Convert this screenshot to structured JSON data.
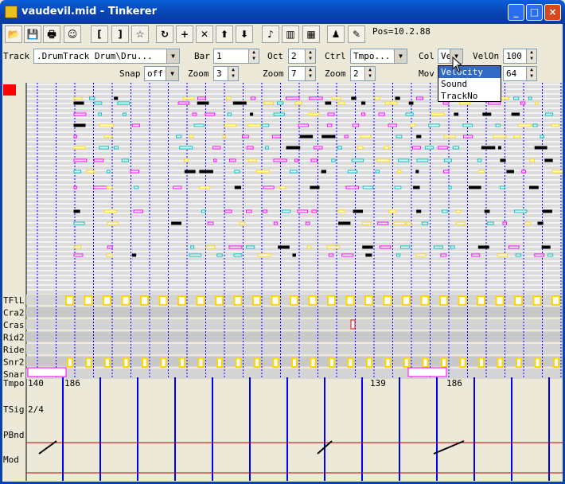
{
  "window": {
    "title": "vaudevil.mid - Tinkerer",
    "minimize": "_",
    "maximize": "□",
    "close": "×"
  },
  "toolbar": {
    "buttons": [
      {
        "name": "open-icon",
        "glyph": "📂"
      },
      {
        "name": "save-icon",
        "glyph": "💾"
      },
      {
        "name": "print-icon",
        "glyph": "🖶"
      },
      {
        "name": "smiley-icon",
        "glyph": "☺"
      },
      {
        "name": "bracket-open-button",
        "glyph": "["
      },
      {
        "name": "bracket-close-button",
        "glyph": "]"
      },
      {
        "name": "star-button",
        "glyph": "☆"
      },
      {
        "name": "loop-icon",
        "glyph": "↻"
      },
      {
        "name": "add-icon",
        "glyph": "+"
      },
      {
        "name": "delete-icon",
        "glyph": "✕"
      },
      {
        "name": "arrow-up-icon",
        "glyph": "⬆"
      },
      {
        "name": "arrow-down-icon",
        "glyph": "⬇"
      },
      {
        "name": "note-icon",
        "glyph": "♪"
      },
      {
        "name": "bars-icon",
        "glyph": "▥"
      },
      {
        "name": "measures-icon",
        "glyph": "▦"
      },
      {
        "name": "player-icon",
        "glyph": "♟"
      },
      {
        "name": "edit-icon",
        "glyph": "✎"
      }
    ],
    "position": "Pos=10.2.88"
  },
  "controls": {
    "track_label": "Track",
    "track_value": ".DrumTrack  Drum\\Dru...",
    "bar_label": "Bar",
    "bar_value": "1",
    "oct_label": "Oct",
    "oct_value": "2",
    "ctrl_label": "Ctrl",
    "ctrl_value": "Tmpo...",
    "col_label": "Col",
    "col_value": "Ve",
    "velon_label": "VelOn",
    "velon_value": "100",
    "snap_label": "Snap",
    "snap_value": "off",
    "zoom1_label": "Zoom",
    "zoom1_value": "3",
    "zoom2_label": "Zoom",
    "zoom2_value": "7",
    "zoom3_label": "Zoom",
    "zoom3_value": "2",
    "mov_label": "Mov",
    "mov_value": "64"
  },
  "col_dropdown": {
    "options": [
      "Velocity",
      "Sound",
      "TrackNo"
    ],
    "selected": "Velocity"
  },
  "drum_rows": [
    "TFlL",
    "Cra2",
    "Cras",
    "Rid2",
    "Ride",
    "Snr2",
    "Snar"
  ],
  "ctrl_rows": [
    {
      "label": "Tmpo",
      "values": [
        {
          "text": "140"
        },
        {
          "text": "186"
        },
        {
          "text": "139"
        },
        {
          "text": "186"
        }
      ]
    },
    {
      "label": "TSig",
      "values": [
        {
          "text": "2/4"
        }
      ]
    },
    {
      "label": "PBnd",
      "values": []
    },
    {
      "label": "Mod",
      "values": []
    }
  ],
  "colors": {
    "note_yellow": "#ffd700",
    "note_magenta": "#ff00ff",
    "note_cyan": "#00c0c0",
    "note_black": "#000000",
    "beat_line": "#0000ff",
    "mark_red": "#ff0000"
  }
}
